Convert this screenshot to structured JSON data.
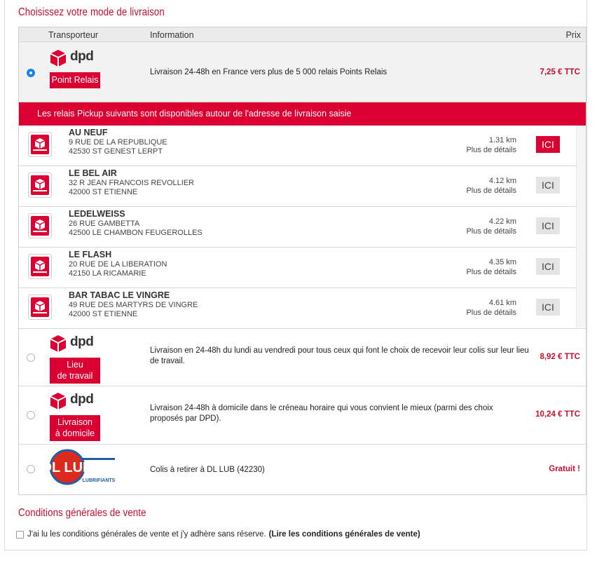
{
  "title": "Choisissez votre mode de livraison",
  "table_headers": {
    "carrier": "Transporteur",
    "info": "Information",
    "price": "Prix"
  },
  "options": [
    {
      "brand": "dpd",
      "tag_lines": [
        "Point Relais"
      ],
      "info": "Livraison 24-48h en France vers plus de 5 000 relais Points Relais",
      "price": "7,25 € TTC",
      "selected": true
    },
    {
      "brand": "dpd",
      "tag_lines": [
        "Lieu",
        "de travail"
      ],
      "info": "Livraison en 24-48h du lundi au vendredi pour tous ceux qui font le choix de recevoir leur colis sur leur lieu de travail.",
      "price": "8,92 € TTC",
      "selected": false
    },
    {
      "brand": "dpd",
      "tag_lines": [
        "Livraison",
        "à domicile"
      ],
      "info": "Livraison 24-48h à domicile dans le créneau horaire qui vous convient le mieux (parmi des choix proposés par DPD).",
      "price": "10,24 € TTC",
      "selected": false
    },
    {
      "brand": "DL LUB",
      "brand_sub": "LUBRIFIANTS",
      "info": "Colis à retirer à DL LUB (42230)",
      "price": "Gratuit !",
      "selected": false
    }
  ],
  "pickup_banner": "Les relais Pickup suivants sont disponibles autour de l'adresse de livraison saisie",
  "pickup_points": [
    {
      "name": "AU NEUF",
      "street": "9 RUE DE LA REPUBLIQUE",
      "city": "42530 ST GENEST LERPT",
      "distance": "1.31 km",
      "details": "Plus de détails",
      "button": "ICI",
      "selected": true
    },
    {
      "name": "LE BEL AIR",
      "street": "32 R JEAN FRANCOIS REVOLLIER",
      "city": "42000 ST ETIENNE",
      "distance": "4.12 km",
      "details": "Plus de détails",
      "button": "ICI",
      "selected": false
    },
    {
      "name": "LEDELWEISS",
      "street": "26 RUE GAMBETTA",
      "city": "42500 LE CHAMBON FEUGEROLLES",
      "distance": "4.22 km",
      "details": "Plus de détails",
      "button": "ICI",
      "selected": false
    },
    {
      "name": "LE FLASH",
      "street": "20 RUE DE LA LIBERATION",
      "city": "42150 LA RICAMARIE",
      "distance": "4.35 km",
      "details": "Plus de détails",
      "button": "ICI",
      "selected": false
    },
    {
      "name": "BAR TABAC LE VINGRE",
      "street": "49 RUE DES MARTYRS DE VINGRE",
      "city": "42000 ST ETIENNE",
      "distance": "4.61 km",
      "details": "Plus de détails",
      "button": "ICI",
      "selected": false
    }
  ],
  "cgv": {
    "title": "Conditions générales de vente",
    "checkbox_label": "J'ai lu les conditions générales de vente et j'y adhère sans réserve.",
    "link": "(Lire les conditions générales de vente)",
    "checked": false
  },
  "colors": {
    "brand_red": "#dc0032",
    "title_red": "#c8102e",
    "radio_blue": "#1a82e2"
  },
  "icons": {
    "dpd": "dpd-cube-icon",
    "pickup": "dpd-pickup-icon"
  }
}
